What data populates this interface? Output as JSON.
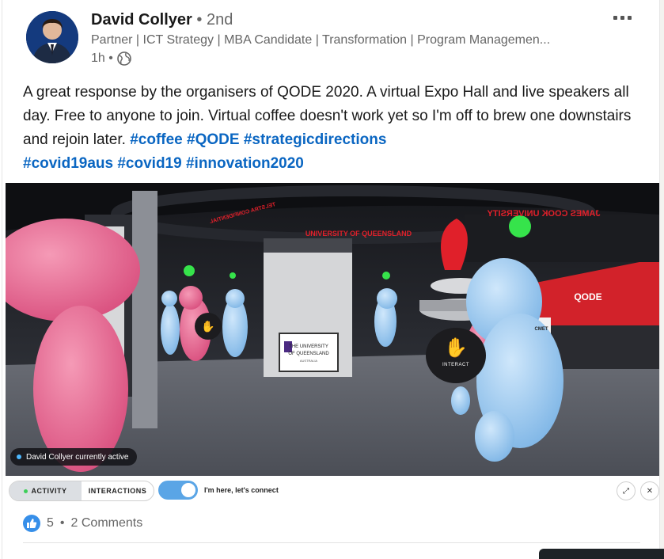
{
  "post": {
    "author": {
      "name": "David Collyer",
      "degree": "• 2nd",
      "headline": "Partner | ICT Strategy | MBA Candidate | Transformation | Program Managemen...",
      "time": "1h •"
    },
    "text_main": "A great response by the organisers of QODE 2020. A virtual Expo Hall and live speakers all day.  Free to anyone to join.  Virtual coffee doesn't work yet so I'm off to brew one downstairs and rejoin later. ",
    "hashtags": [
      "#coffee",
      "#QODE",
      "#strategicdirections",
      "#covid19aus",
      "#covid19",
      "#innovation2020"
    ]
  },
  "media": {
    "status_text": "David Collyer currently active",
    "interact_label": "INTERACT",
    "scene_labels": {
      "jcu": "JAMES COOK UNIVERSITY",
      "uq": "UNIVERSITY OF QUEENSLAND",
      "telstra": "TELSTRA CONFIDENTIAL",
      "qode": "QODE",
      "uq_sign_1": "THE UNIVERSITY",
      "uq_sign_2": "OF QUEENSLAND",
      "uq_sign_3": "AUSTRALIA",
      "cmet": "CMET"
    }
  },
  "toolbar": {
    "tab_activity": "ACTIVITY",
    "tab_interactions": "INTERACTIONS",
    "toggle_label": "I'm here, let's connect",
    "expand_icon": "⤢",
    "close_icon": "✕"
  },
  "social": {
    "reactions": "5",
    "separator": "•",
    "comments": "2 Comments"
  },
  "colors": {
    "link": "#0a66c2",
    "accent_red": "#e0202a",
    "avatar_blue": "#a9d2f5",
    "avatar_pink": "#ee6b95"
  }
}
